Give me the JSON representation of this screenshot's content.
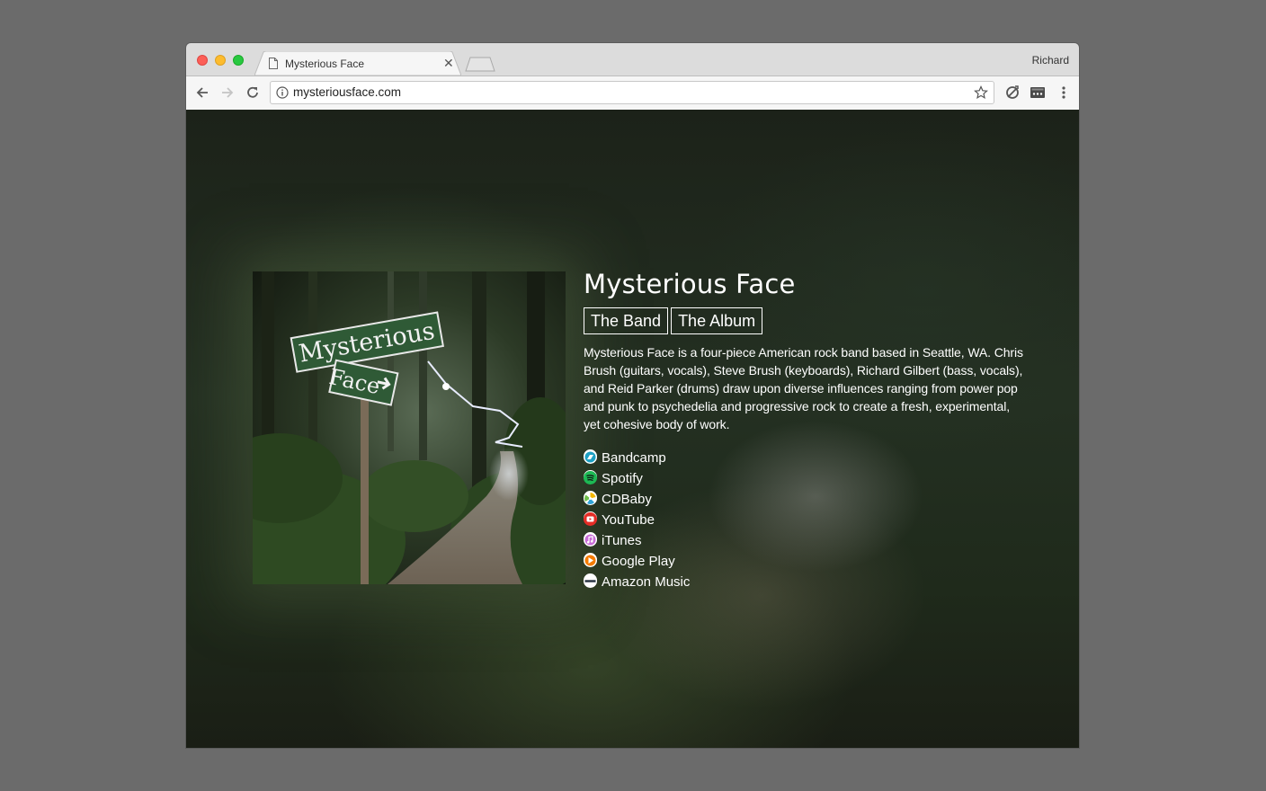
{
  "browser": {
    "tab_title": "Mysterious Face",
    "profile_name": "Richard",
    "url": "mysteriousface.com"
  },
  "page": {
    "band_name": "Mysterious Face",
    "nav": [
      {
        "label": "The Band"
      },
      {
        "label": "The Album"
      }
    ],
    "description": "Mysterious Face is a four-piece American rock band based in Seattle, WA. Chris Brush (guitars, vocals), Steve Brush (keyboards), Richard Gilbert (bass, vocals), and Reid Parker (drums) draw upon diverse influences ranging from power pop and punk to psychedelia and progressive rock to create a fresh, experimental, yet cohesive body of work.",
    "links": [
      {
        "label": "Bandcamp",
        "icon": "bandcamp-icon",
        "color": "#1da0c3"
      },
      {
        "label": "Spotify",
        "icon": "spotify-icon",
        "color": "#1db954"
      },
      {
        "label": "CDBaby",
        "icon": "cdbaby-icon",
        "color": "#f5b800"
      },
      {
        "label": "YouTube",
        "icon": "youtube-icon",
        "color": "#e52d27"
      },
      {
        "label": "iTunes",
        "icon": "itunes-icon",
        "color": "#c86dd7"
      },
      {
        "label": "Google Play",
        "icon": "google-play-icon",
        "color": "#f57c00"
      },
      {
        "label": "Amazon Music",
        "icon": "amazon-music-icon",
        "color": "#232f3e"
      }
    ],
    "album_sign_top": "Mysterious",
    "album_sign_bottom": "Face"
  }
}
